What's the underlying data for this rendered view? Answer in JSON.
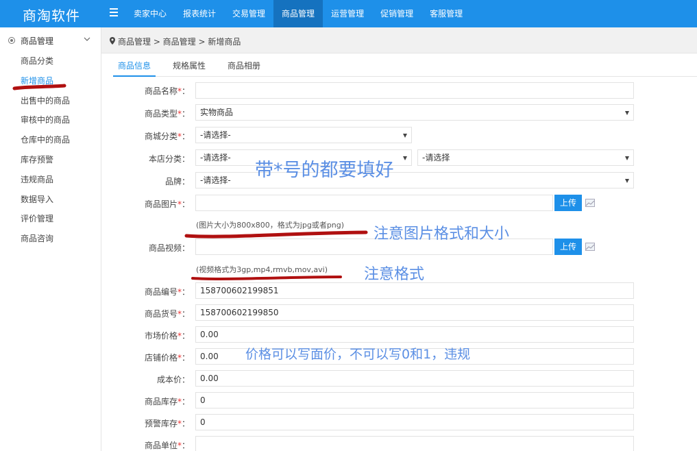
{
  "header": {
    "logo": "商淘软件",
    "nav": [
      "卖家中心",
      "报表统计",
      "交易管理",
      "商品管理",
      "运营管理",
      "促销管理",
      "客服管理"
    ],
    "active_nav": "商品管理"
  },
  "sidebar": {
    "title": "商品管理",
    "items": [
      "商品分类",
      "新增商品",
      "出售中的商品",
      "审核中的商品",
      "仓库中的商品",
      "库存预警",
      "违规商品",
      "数据导入",
      "评价管理",
      "商品咨询"
    ],
    "active_item": "新增商品"
  },
  "breadcrumb": "商品管理 > 商品管理 > 新增商品",
  "tabs": [
    "商品信息",
    "规格属性",
    "商品相册"
  ],
  "form": {
    "name_label": "商品名称",
    "type_label": "商品类型",
    "type_value": "实物商品",
    "mall_cat_label": "商城分类",
    "mall_cat_value": "-请选择-",
    "shop_cat_label": "本店分类",
    "shop_cat_value1": "-请选择-",
    "shop_cat_value2": "-请选择",
    "brand_label": "品牌",
    "brand_value": "-请选择-",
    "image_label": "商品图片",
    "image_hint": "(图片大小为800x800，格式为jpg或者png)",
    "video_label": "商品视频",
    "video_hint": "(视频格式为3gp,mp4,rmvb,mov,avi)",
    "upload_label": "上传",
    "sn_label": "商品编号",
    "sn_value": "158700602199851",
    "goods_no_label": "商品货号",
    "goods_no_value": "158700602199850",
    "market_price_label": "市场价格",
    "market_price_value": "0.00",
    "shop_price_label": "店铺价格",
    "shop_price_value": "0.00",
    "cost_price_label": "成本价",
    "cost_price_value": "0.00",
    "stock_label": "商品库存",
    "stock_value": "0",
    "warn_stock_label": "预警库存",
    "warn_stock_value": "0",
    "unit_label": "商品单位",
    "colon": "：",
    "required_mark": "*"
  },
  "annotations": {
    "required_note": "带*号的都要填好",
    "image_note": "注意图片格式和大小",
    "video_note": "注意格式",
    "price_note": "价格可以写面价，不可以写0和1，违规"
  },
  "colors": {
    "primary": "#1e90e9",
    "nav_active": "#1572bf",
    "annotation": "#5b8fe4",
    "ink": "#b01010"
  }
}
